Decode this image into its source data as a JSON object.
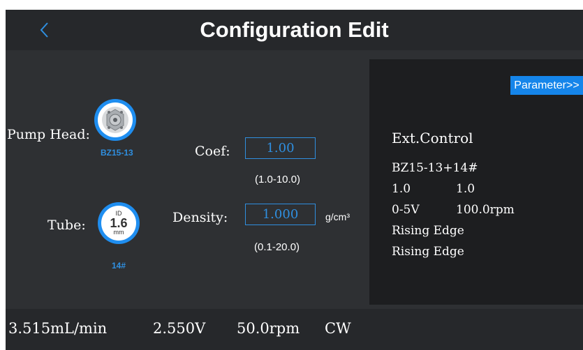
{
  "header": {
    "title": "Configuration Edit",
    "back_icon": "chevron-left-icon"
  },
  "pump_head": {
    "label": "Pump Head:",
    "model": "BZ15-13",
    "icon": "pump-head-icon"
  },
  "tube": {
    "label": "Tube:",
    "id_label": "ID",
    "size": "1.6",
    "unit": "mm",
    "number": "14#"
  },
  "coef": {
    "label": "Coef:",
    "value": "1.00",
    "range": "(1.0-10.0)"
  },
  "density": {
    "label": "Density:",
    "value": "1.000",
    "unit": "g/cm³",
    "range": "(0.1-20.0)"
  },
  "right_panel": {
    "parameter_button": "Parameter>>",
    "title": "Ext.Control",
    "config": "BZ15-13+14#",
    "coef_value": "1.0",
    "density_value": "1.0",
    "voltage_range": "0-5V",
    "speed": "100.0rpm",
    "edge1": "Rising Edge",
    "edge2": "Rising Edge"
  },
  "status_bar": {
    "flow": "3.515mL/min",
    "voltage": "2.550V",
    "speed": "50.0rpm",
    "direction": "CW"
  },
  "colors": {
    "accent": "#2f8fe0",
    "background": "#2e3033",
    "panel_dark": "#1d1e20",
    "header": "#26282b"
  }
}
